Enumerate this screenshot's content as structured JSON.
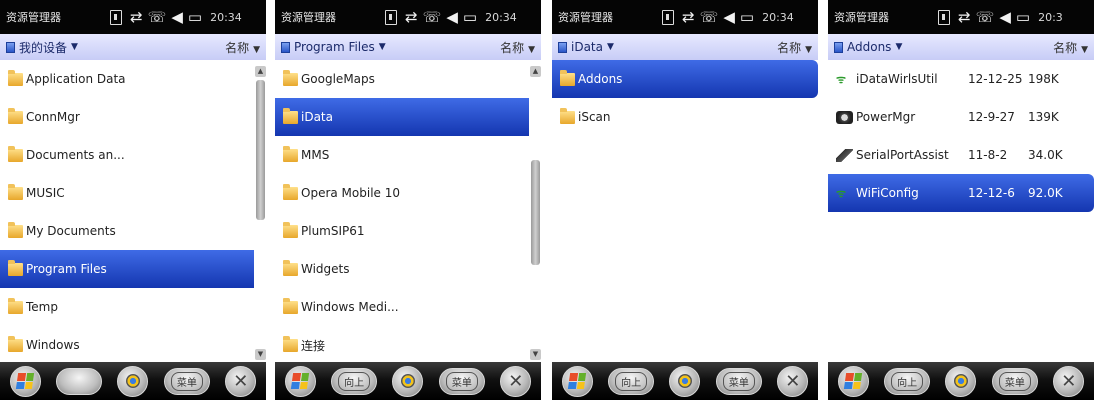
{
  "status": {
    "app_title": "资源管理器",
    "times": [
      "20:34",
      "20:34",
      "20:34",
      "20:3"
    ]
  },
  "screens": [
    {
      "folder": "我的设备",
      "sort": "名称",
      "left_button": "",
      "items": [
        {
          "name": "Application Data",
          "icon": "folder-icon"
        },
        {
          "name": "ConnMgr",
          "icon": "folder-icon"
        },
        {
          "name": "Documents an...",
          "icon": "folder-icon"
        },
        {
          "name": "MUSIC",
          "icon": "folder-icon"
        },
        {
          "name": "My Documents",
          "icon": "folder-icon"
        },
        {
          "name": "Program Files",
          "icon": "folder-icon"
        },
        {
          "name": "Temp",
          "icon": "folder-icon"
        },
        {
          "name": "Windows",
          "icon": "folder-icon"
        }
      ],
      "selected": 5
    },
    {
      "folder": "Program Files",
      "sort": "名称",
      "left_button": "向上",
      "items": [
        {
          "name": "GoogleMaps",
          "icon": "folder-icon"
        },
        {
          "name": "iData",
          "icon": "folder-icon"
        },
        {
          "name": "MMS",
          "icon": "folder-icon"
        },
        {
          "name": "Opera Mobile 10",
          "icon": "folder-icon"
        },
        {
          "name": "PlumSIP61",
          "icon": "folder-icon"
        },
        {
          "name": "Widgets",
          "icon": "folder-icon"
        },
        {
          "name": "Windows Medi...",
          "icon": "folder-icon"
        },
        {
          "name": "连接",
          "icon": "folder-icon"
        }
      ],
      "selected": 1
    },
    {
      "folder": "iData",
      "sort": "名称",
      "left_button": "向上",
      "items": [
        {
          "name": "Addons",
          "icon": "folder-icon"
        },
        {
          "name": "iScan",
          "icon": "folder-icon"
        }
      ],
      "selected": 0
    },
    {
      "folder": "Addons",
      "sort": "名称",
      "left_button": "向上",
      "items": [
        {
          "name": "iDataWirlsUtil",
          "icon": "wifi-app-icon",
          "date": "12-12-25",
          "size": "198K"
        },
        {
          "name": "PowerMgr",
          "icon": "power-app-icon",
          "date": "12-9-27",
          "size": "139K"
        },
        {
          "name": "SerialPortAssist",
          "icon": "serial-app-icon",
          "date": "11-8-2",
          "size": "34.0K"
        },
        {
          "name": "WiFiConfig",
          "icon": "wifi-app-icon",
          "date": "12-12-6",
          "size": "92.0K"
        }
      ],
      "selected": 3
    }
  ],
  "softkeys": {
    "menu": "菜单"
  }
}
